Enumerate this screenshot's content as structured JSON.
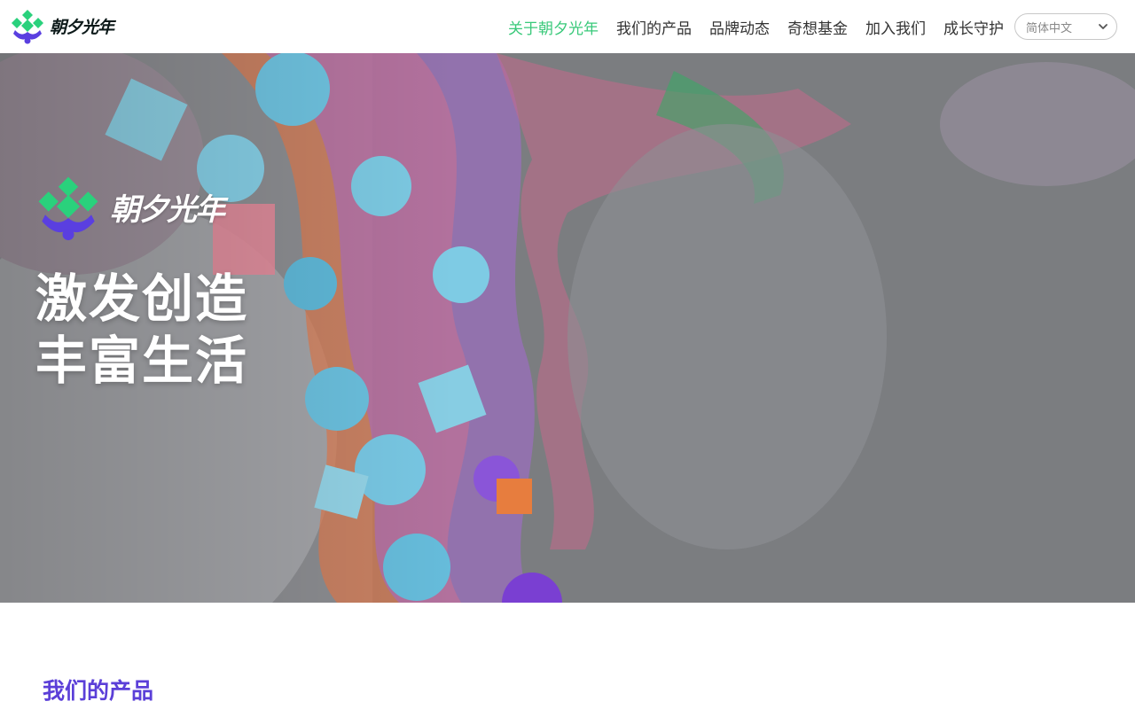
{
  "header": {
    "logo_text": "朝夕光年",
    "nav": [
      {
        "label": "关于朝夕光年",
        "active": true
      },
      {
        "label": "我们的产品",
        "active": false
      },
      {
        "label": "品牌动态",
        "active": false
      },
      {
        "label": "奇想基金",
        "active": false
      },
      {
        "label": "加入我们",
        "active": false
      },
      {
        "label": "成长守护",
        "active": false
      }
    ],
    "language": {
      "selected": "简体中文"
    }
  },
  "hero": {
    "logo_text": "朝夕光年",
    "headline_line1": "激发创造",
    "headline_line2": "丰富生活"
  },
  "products_section": {
    "title": "我们的产品"
  },
  "colors": {
    "accent_green": "#39c97a",
    "brand_purple": "#5b3fd8",
    "logo_green": "#2ad17c",
    "logo_purple": "#5a3fe0"
  },
  "icons": {
    "logo": "zhaoxi-logo-icon",
    "dropdown": "chevron-down-icon"
  }
}
